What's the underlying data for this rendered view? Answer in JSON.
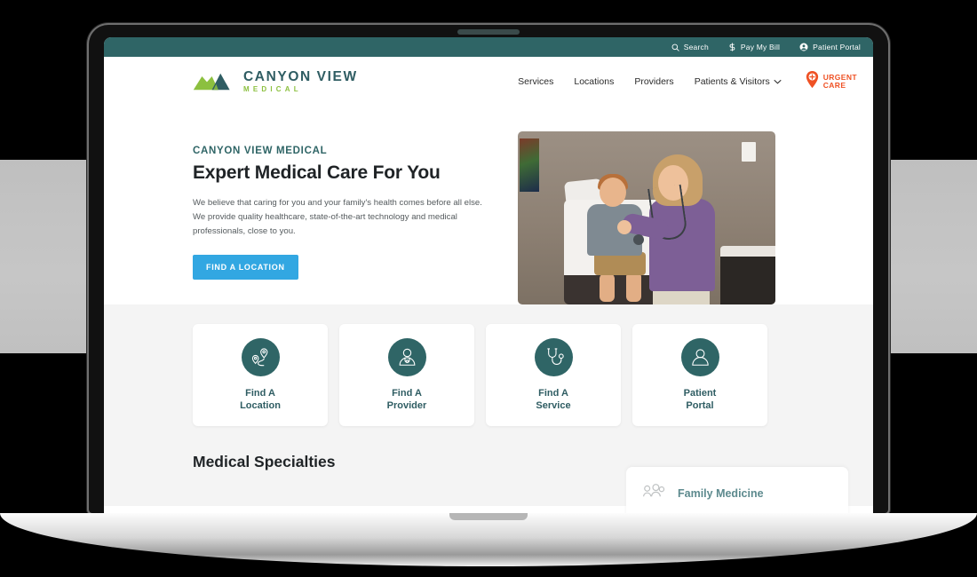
{
  "colors": {
    "teal": "#2f6566",
    "teal_text": "#2f5d63",
    "green": "#8cc03f",
    "orange": "#ef5124",
    "cta_blue": "#32a7e2",
    "page_bg": "#f4f4f4"
  },
  "utility_bar": {
    "links": [
      {
        "label": "Search",
        "icon": "search-icon"
      },
      {
        "label": "Pay My Bill",
        "icon": "dollar-icon"
      },
      {
        "label": "Patient Portal",
        "icon": "user-circle-icon"
      }
    ]
  },
  "header": {
    "logo": {
      "name": "CANYON VIEW",
      "sub": "MEDICAL",
      "icon": "mountain-logo-icon"
    },
    "nav": [
      {
        "label": "Services",
        "has_caret": false
      },
      {
        "label": "Locations",
        "has_caret": false
      },
      {
        "label": "Providers",
        "has_caret": false
      },
      {
        "label": "Patients & Visitors",
        "has_caret": true
      }
    ],
    "urgent_care": {
      "line1": "URGENT",
      "line2": "CARE",
      "icon": "map-pin-plus-icon"
    }
  },
  "hero": {
    "eyebrow": "CANYON VIEW MEDICAL",
    "title": "Expert Medical Care For You",
    "body": "We believe that caring for you and your family's health comes before all else. We provide quality healthcare, state-of-the-art technology and medical professionals, close to you.",
    "cta_label": "FIND A LOCATION",
    "image_alt": "Doctor examining a young boy with a stethoscope in an exam room"
  },
  "quick_links": [
    {
      "label_line1": "Find A",
      "label_line2": "Location",
      "icon": "map-route-pin-icon"
    },
    {
      "label_line1": "Find A",
      "label_line2": "Provider",
      "icon": "doctor-person-icon"
    },
    {
      "label_line1": "Find A",
      "label_line2": "Service",
      "icon": "stethoscope-icon"
    },
    {
      "label_line1": "Patient",
      "label_line2": "Portal",
      "icon": "person-icon"
    }
  ],
  "specialties": {
    "title": "Medical Specialties",
    "featured_card": {
      "label": "Family Medicine",
      "icon": "family-icon"
    }
  }
}
